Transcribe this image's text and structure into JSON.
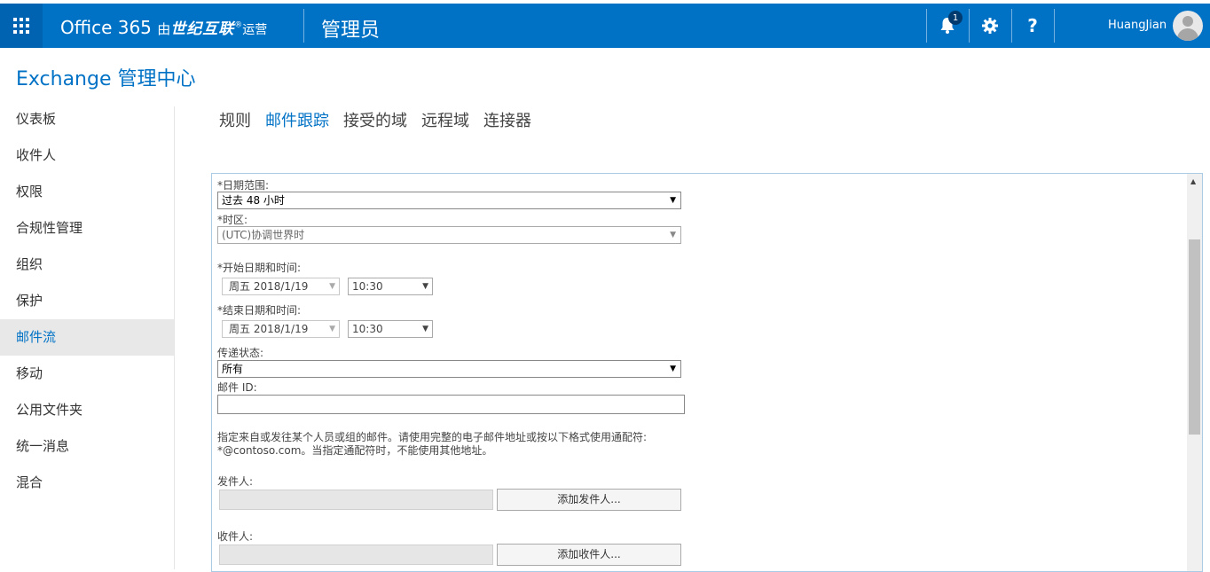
{
  "topbar": {
    "brand_prefix": "Office 365",
    "brand_by": "由",
    "brand_partner": "世纪互联",
    "brand_mark": "®",
    "brand_suffix": "运营",
    "section": "管理员",
    "notifications_count": "1",
    "help_glyph": "?",
    "username": "HuangJian"
  },
  "header": {
    "title": "Exchange 管理中心"
  },
  "nav": {
    "items": [
      "仪表板",
      "收件人",
      "权限",
      "合规性管理",
      "组织",
      "保护",
      "邮件流",
      "移动",
      "公用文件夹",
      "统一消息",
      "混合"
    ],
    "active": "邮件流"
  },
  "tabs": {
    "items": [
      "规则",
      "邮件跟踪",
      "接受的域",
      "远程域",
      "连接器"
    ],
    "active": "邮件跟踪"
  },
  "form": {
    "date_range_label": "*日期范围:",
    "date_range_value": "过去 48 小时",
    "timezone_label": "*时区:",
    "timezone_value": "(UTC)协调世界时",
    "start_label": "*开始日期和时间:",
    "start_date": "周五 2018/1/19",
    "start_time": "10:30",
    "end_label": "*结束日期和时间:",
    "end_date": "周五 2018/1/19",
    "end_time": "10:30",
    "status_label": "传递状态:",
    "status_value": "所有",
    "message_id_label": "邮件 ID:",
    "message_id_value": "",
    "note_line1": "指定来自或发往某个人员或组的邮件。请使用完整的电子邮件地址或按以下格式使用通配符:",
    "note_line2": "*@contoso.com。当指定通配符时，不能使用其他地址。",
    "sender_label": "发件人:",
    "add_sender_button": "添加发件人...",
    "recipient_label": "收件人:",
    "add_recipient_button": "添加收件人..."
  },
  "colors": {
    "accent": "#0072c6",
    "waffle": "#0063b1",
    "nav_active_bg": "#e8e8e8"
  }
}
